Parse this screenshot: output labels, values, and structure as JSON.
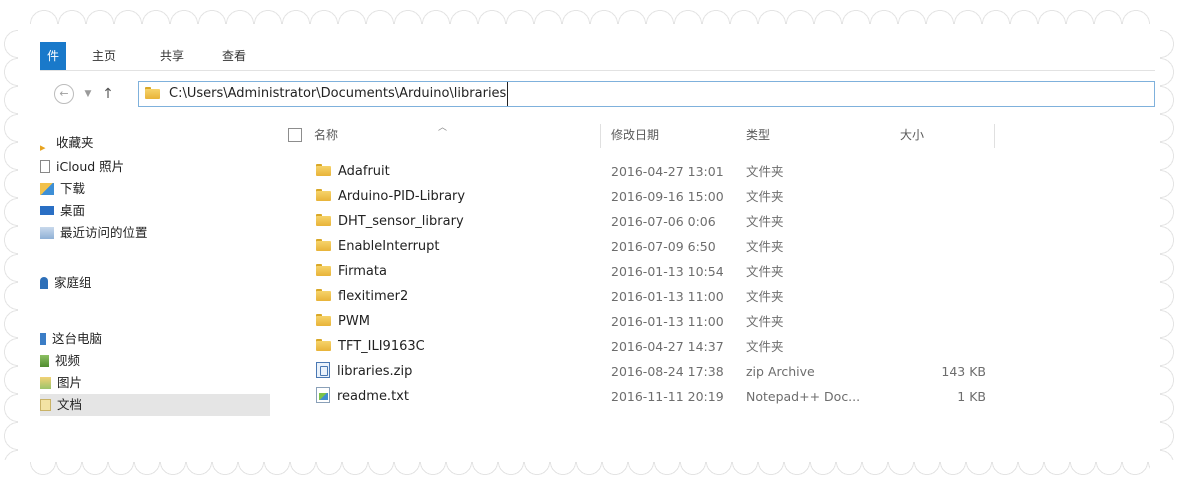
{
  "ribbon": {
    "file_tab": "件",
    "tabs": [
      "主页",
      "共享",
      "查看"
    ]
  },
  "address_bar": {
    "path": "C:\\Users\\Administrator\\Documents\\Arduino\\libraries"
  },
  "nav_pane": {
    "items": [
      {
        "label": "收藏夹",
        "icon": "star-icon"
      },
      {
        "label": "iCloud 照片",
        "icon": "photo-icon"
      },
      {
        "label": "下载",
        "icon": "download-icon"
      },
      {
        "label": "桌面",
        "icon": "desktop-icon"
      },
      {
        "label": "最近访问的位置",
        "icon": "recent-icon"
      },
      {
        "label": "家庭组",
        "icon": "homegroup-icon"
      },
      {
        "label": "这台电脑",
        "icon": "computer-icon"
      },
      {
        "label": "视频",
        "icon": "video-icon"
      },
      {
        "label": "图片",
        "icon": "picture-icon"
      },
      {
        "label": "文档",
        "icon": "document-icon"
      }
    ]
  },
  "columns": {
    "name": "名称",
    "date": "修改日期",
    "type": "类型",
    "size": "大小"
  },
  "files": [
    {
      "name": "Adafruit",
      "date": "2016-04-27 13:01",
      "type": "文件夹",
      "size": "",
      "icon": "folder-icon"
    },
    {
      "name": "Arduino-PID-Library",
      "date": "2016-09-16 15:00",
      "type": "文件夹",
      "size": "",
      "icon": "folder-icon"
    },
    {
      "name": "DHT_sensor_library",
      "date": "2016-07-06 0:06",
      "type": "文件夹",
      "size": "",
      "icon": "folder-icon"
    },
    {
      "name": "EnableInterrupt",
      "date": "2016-07-09 6:50",
      "type": "文件夹",
      "size": "",
      "icon": "folder-icon"
    },
    {
      "name": "Firmata",
      "date": "2016-01-13 10:54",
      "type": "文件夹",
      "size": "",
      "icon": "folder-icon"
    },
    {
      "name": "flexitimer2",
      "date": "2016-01-13 11:00",
      "type": "文件夹",
      "size": "",
      "icon": "folder-icon"
    },
    {
      "name": "PWM",
      "date": "2016-01-13 11:00",
      "type": "文件夹",
      "size": "",
      "icon": "folder-icon"
    },
    {
      "name": "TFT_ILI9163C",
      "date": "2016-04-27 14:37",
      "type": "文件夹",
      "size": "",
      "icon": "folder-icon"
    },
    {
      "name": "libraries.zip",
      "date": "2016-08-24 17:38",
      "type": "zip Archive",
      "size": "143 KB",
      "icon": "zip-icon"
    },
    {
      "name": "readme.txt",
      "date": "2016-11-11 20:19",
      "type": "Notepad++ Doc...",
      "size": "1 KB",
      "icon": "text-file-icon"
    }
  ]
}
